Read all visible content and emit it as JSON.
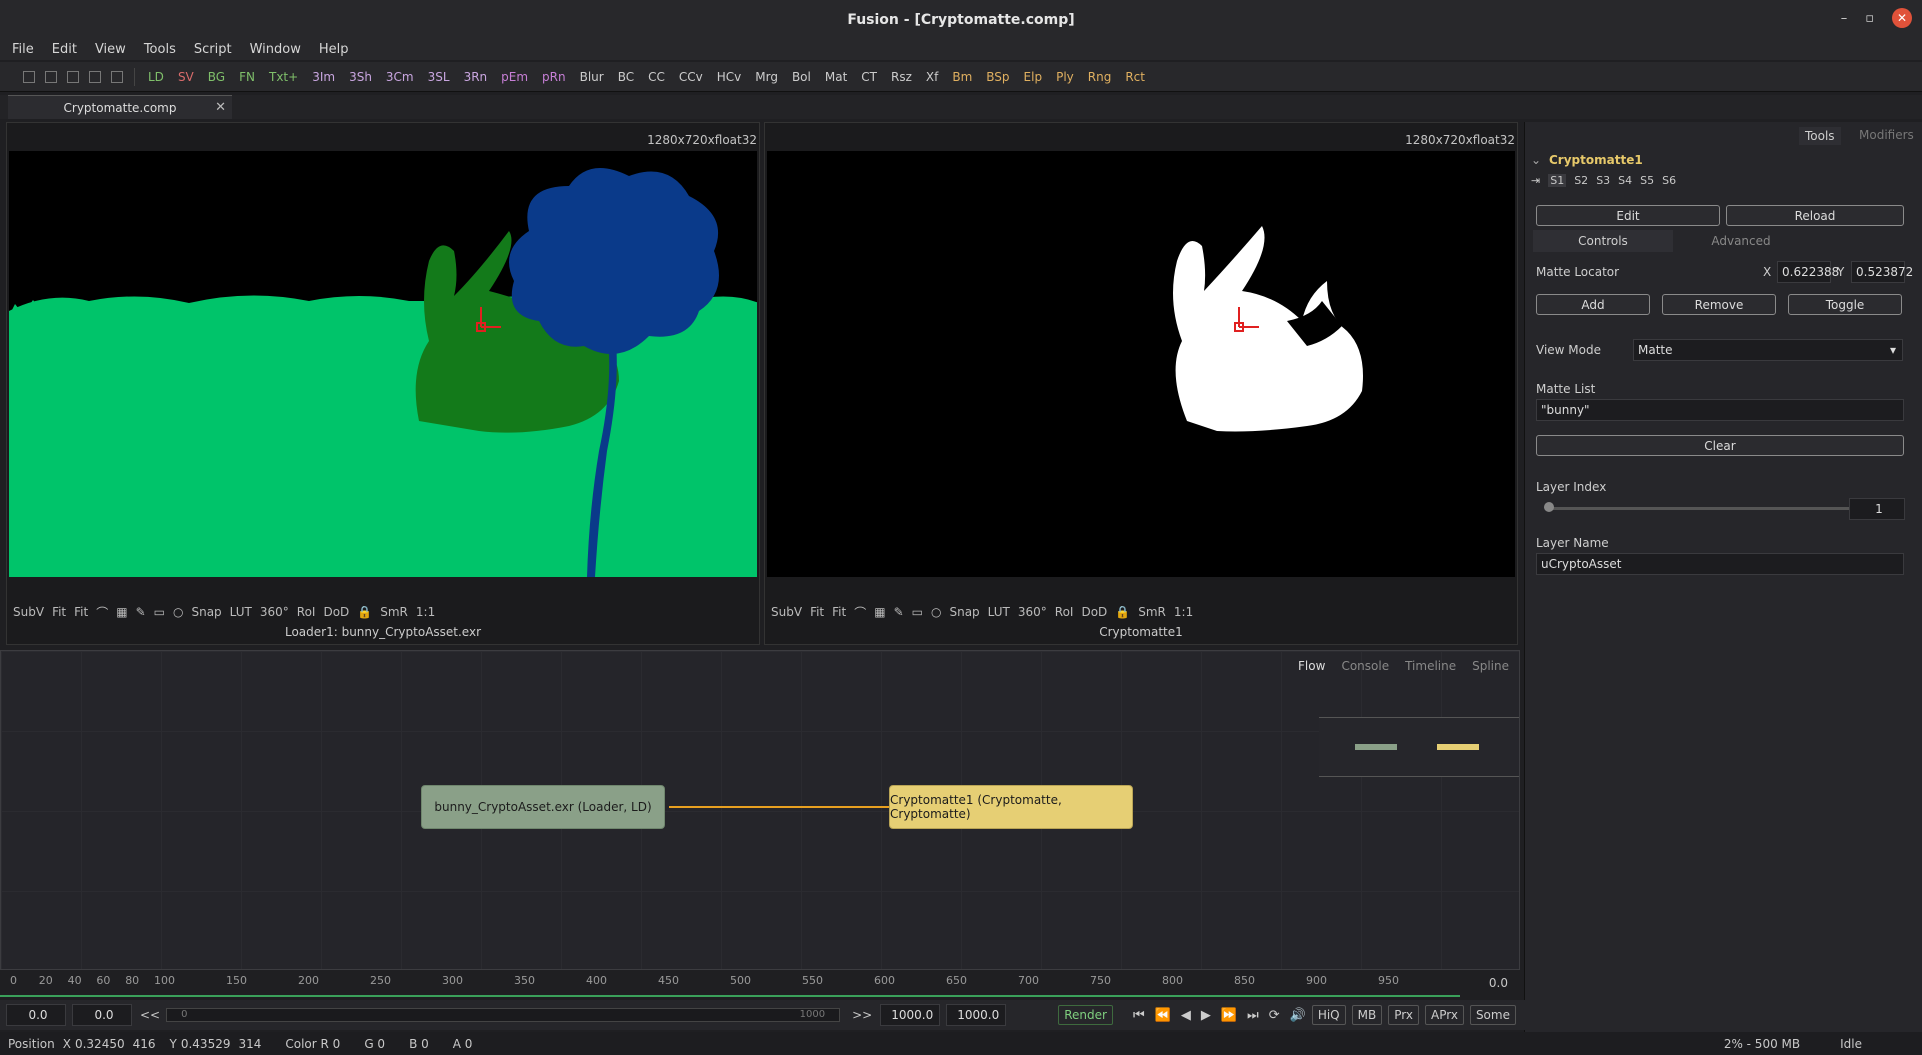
{
  "window": {
    "title": "Fusion - [Cryptomatte.comp]",
    "min": "–",
    "max": "▫",
    "close": "✕"
  },
  "menu": [
    "File",
    "Edit",
    "View",
    "Tools",
    "Script",
    "Window",
    "Help"
  ],
  "toolbar": {
    "buttons": [
      {
        "label": "LD",
        "color": "#7fbf6a"
      },
      {
        "label": "SV",
        "color": "#d86b6b"
      },
      {
        "label": "BG",
        "color": "#7fbf6a"
      },
      {
        "label": "FN",
        "color": "#7fbf6a"
      },
      {
        "label": "Txt+",
        "color": "#7fbf6a"
      },
      {
        "label": "3Im",
        "color": "#c9a6e0"
      },
      {
        "label": "3Sh",
        "color": "#c9a6e0"
      },
      {
        "label": "3Cm",
        "color": "#c9a6e0"
      },
      {
        "label": "3SL",
        "color": "#c9a6e0"
      },
      {
        "label": "3Rn",
        "color": "#c9a6e0"
      },
      {
        "label": "pEm",
        "color": "#c77fd6"
      },
      {
        "label": "pRn",
        "color": "#c77fd6"
      },
      {
        "label": "Blur",
        "color": "#cccccc"
      },
      {
        "label": "BC",
        "color": "#cccccc"
      },
      {
        "label": "CC",
        "color": "#cccccc"
      },
      {
        "label": "CCv",
        "color": "#cccccc"
      },
      {
        "label": "HCv",
        "color": "#cccccc"
      },
      {
        "label": "Mrg",
        "color": "#cccccc"
      },
      {
        "label": "Bol",
        "color": "#cccccc"
      },
      {
        "label": "Mat",
        "color": "#cccccc"
      },
      {
        "label": "CT",
        "color": "#cccccc"
      },
      {
        "label": "Rsz",
        "color": "#cccccc"
      },
      {
        "label": "Xf",
        "color": "#cccccc"
      },
      {
        "label": "Bm",
        "color": "#e0b060"
      },
      {
        "label": "BSp",
        "color": "#e0b060"
      },
      {
        "label": "Elp",
        "color": "#e0b060"
      },
      {
        "label": "Ply",
        "color": "#e0b060"
      },
      {
        "label": "Rng",
        "color": "#e0b060"
      },
      {
        "label": "Rct",
        "color": "#e0b060"
      }
    ]
  },
  "tab": {
    "label": "Cryptomatte.comp",
    "close": "✕"
  },
  "viewer_left": {
    "res": "1280x720xfloat32",
    "name": "Loader1: bunny_CryptoAsset.exr"
  },
  "viewer_right": {
    "res": "1280x720xfloat32",
    "name": "Cryptomatte1"
  },
  "viewer_tools": [
    "SubV",
    "Fit",
    "Fit",
    "Snap",
    "LUT",
    "360°",
    "RoI",
    "DoD",
    "SmR",
    "1:1"
  ],
  "inspector": {
    "tabs": {
      "tools": "Tools",
      "modifiers": "Modifiers"
    },
    "node_name": "Cryptomatte1",
    "slots": [
      "S1",
      "S2",
      "S3",
      "S4",
      "S5",
      "S6"
    ],
    "edit": "Edit",
    "reload": "Reload",
    "controls_tab": "Controls",
    "advanced_tab": "Advanced",
    "matte_locator": "Matte Locator",
    "x_label": "X",
    "x_value": "0.622388",
    "y_label": "Y",
    "y_value": "0.523872",
    "add": "Add",
    "remove": "Remove",
    "toggle": "Toggle",
    "view_mode_label": "View Mode",
    "view_mode_value": "Matte",
    "matte_list_label": "Matte List",
    "matte_list_value": "\"bunny\"",
    "clear": "Clear",
    "layer_index_label": "Layer Index",
    "layer_index_value": "1",
    "layer_name_label": "Layer Name",
    "layer_name_value": "uCryptoAsset"
  },
  "flow": {
    "tabs": [
      "Flow",
      "Console",
      "Timeline",
      "Spline"
    ],
    "nodes": [
      {
        "label": "bunny_CryptoAsset.exr  (Loader, LD)",
        "color": "#8aa088"
      },
      {
        "label": "Cryptomatte1  (Cryptomatte, Cryptomatte)",
        "color": "#e6cf74"
      }
    ]
  },
  "timeline": {
    "ticks": [
      "0",
      "20",
      "40",
      "60",
      "80",
      "100",
      "150",
      "200",
      "250",
      "300",
      "350",
      "400",
      "450",
      "500",
      "550",
      "600",
      "650",
      "700",
      "750",
      "800",
      "850",
      "900",
      "950"
    ],
    "current": "0.0"
  },
  "transport": {
    "start": "0.0",
    "render_start": "0.0",
    "range_end_label": "1000",
    "range_start_label": "0",
    "end": "1000.0",
    "global_end": "1000.0",
    "render": "Render",
    "buttons": [
      "HiQ",
      "MB",
      "Prx",
      "APrx",
      "Some"
    ]
  },
  "status": {
    "position": "Position",
    "x_label": "X",
    "x_value": "0.32450",
    "x_px": "416",
    "y_label": "Y",
    "y_value": "0.43529",
    "y_px": "314",
    "color_r": "Color R 0",
    "g": "G 0",
    "b": "B 0",
    "a": "A 0",
    "mem": "2% - 500 MB",
    "state": "Idle"
  }
}
